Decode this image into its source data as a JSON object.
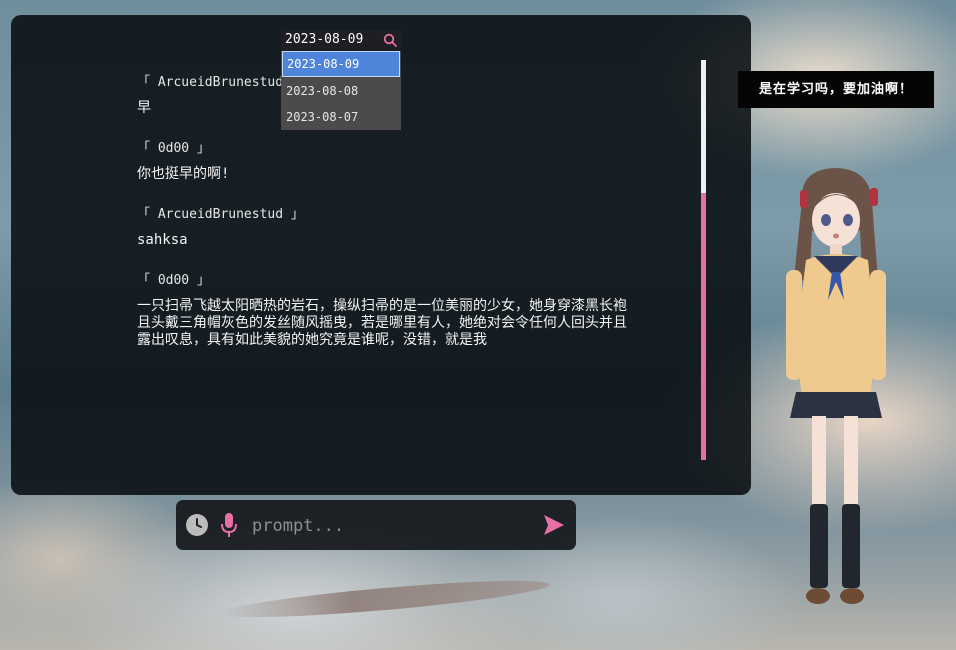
{
  "chat": {
    "messages": [
      {
        "sender": "「 ArcueidBrunestud 」",
        "text": "早"
      },
      {
        "sender": "「 0d00 」",
        "text": "你也挺早的啊!"
      },
      {
        "sender": "「 ArcueidBrunestud 」",
        "text": "sahksa"
      },
      {
        "sender": "「 0d00 」",
        "text": "一只扫帚飞越太阳晒热的岩石，操纵扫帚的是一位美丽的少女，她身穿漆黑长袍且头戴三角帽灰色的发丝随风摇曳，若是哪里有人，她绝对会令任何人回头并且露出叹息，具有如此美貌的她究竟是谁呢，没错，就是我"
      }
    ]
  },
  "date_picker": {
    "value": "2023-08-09",
    "options": [
      "2023-08-09",
      "2023-08-08",
      "2023-08-07"
    ],
    "selected_index": 0
  },
  "tooltip": {
    "text": "是在学习吗，要加油啊！"
  },
  "input_bar": {
    "placeholder": "prompt..."
  },
  "scroll": {
    "position": 0.33
  },
  "icons": {
    "history": "clock-icon",
    "voice": "microphone-icon",
    "send": "send-icon",
    "search": "search-icon"
  },
  "colors": {
    "accent": "#e56fa6",
    "selected": "#4e84d9",
    "panel": "#060a0e"
  }
}
